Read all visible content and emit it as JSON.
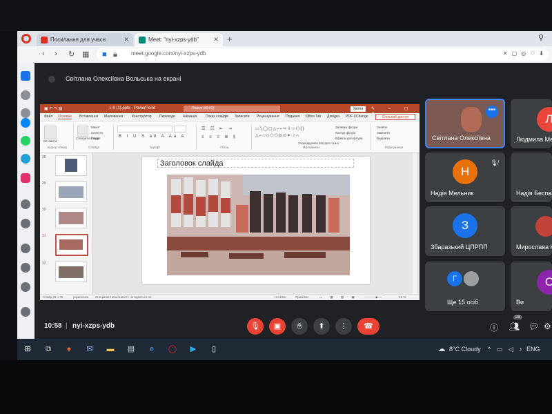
{
  "browser": {
    "tabs": [
      {
        "title": "Посилання для учасн",
        "active": false
      },
      {
        "title": "Meet: \"nyi-xzps-ydb\"",
        "active": true
      }
    ],
    "url": "meet.google.com/nyi-xzps-ydb"
  },
  "meet": {
    "presenting_text": "Світлана Олексіївна Вольська на екрані",
    "time": "10:58",
    "meeting_code": "nyi-xzps-ydb",
    "participants_count": "23",
    "tiles": [
      {
        "name": "Світлана Олексіївна",
        "initial": "",
        "color": "#6d4c41"
      },
      {
        "name": "Людмила Ме",
        "initial": "Л",
        "color": "#e8453c"
      },
      {
        "name": "Надія Мельник",
        "initial": "Н",
        "color": "#e8710a"
      },
      {
        "name": "Надія Беспал",
        "initial": "",
        "color": "#5f6368"
      },
      {
        "name": "Збаразький ЦПРПП",
        "initial": "З",
        "color": "#1a73e8"
      },
      {
        "name": "Мирослава К",
        "initial": "",
        "color": "#8e24aa"
      },
      {
        "name": "Ще 15 осіб",
        "initial": "Г",
        "color": "#1a73e8"
      },
      {
        "name": "Ви",
        "initial": "С",
        "color": "#8e24aa"
      }
    ]
  },
  "ppt": {
    "title": "1-8 (1).pptx - PowerPoint",
    "search": "Пошук (Alt+Q)",
    "signin": "Увійти",
    "share": "Спільний доступ",
    "tabs": [
      "Файл",
      "Основне",
      "Вставлення",
      "Малювання",
      "Конструктор",
      "Переходи",
      "Анімація",
      "Показ слайдів",
      "Записати",
      "Рецензування",
      "Подання",
      "Office Tab",
      "Довідка",
      "PDF-XChange"
    ],
    "ribbon_groups": [
      "Буфер обміну",
      "Слайди",
      "Шрифт",
      "Абзац",
      "Малювання",
      "Редагування"
    ],
    "ribbon_buttons": [
      "Вставити",
      "Створити слайд",
      "Макет",
      "Скинути",
      "Розділ",
      "Упорядкувати",
      "Експрес-стилі",
      "Заливка фігури",
      "Контур фігури",
      "Ефекти для фігури",
      "Знайти",
      "Замінити",
      "Виділити"
    ],
    "slide_numbers": [
      "28",
      "29",
      "30",
      "31",
      "32"
    ],
    "slide_title": "Заголовок слайда",
    "status_left": "Слайд 31 з 78",
    "status_lang": "українська",
    "status_mid": "Спеціальні можливості: не вдається пе",
    "status_notes": "Нотатки",
    "status_comments": "Примітки",
    "zoom": "45 %"
  },
  "taskbar": {
    "weather": "8°C Cloudy",
    "lang": "ENG"
  },
  "colors": {
    "meet_bg": "#202124",
    "ppt_accent": "#b7472a",
    "end_call": "#ea4335"
  }
}
